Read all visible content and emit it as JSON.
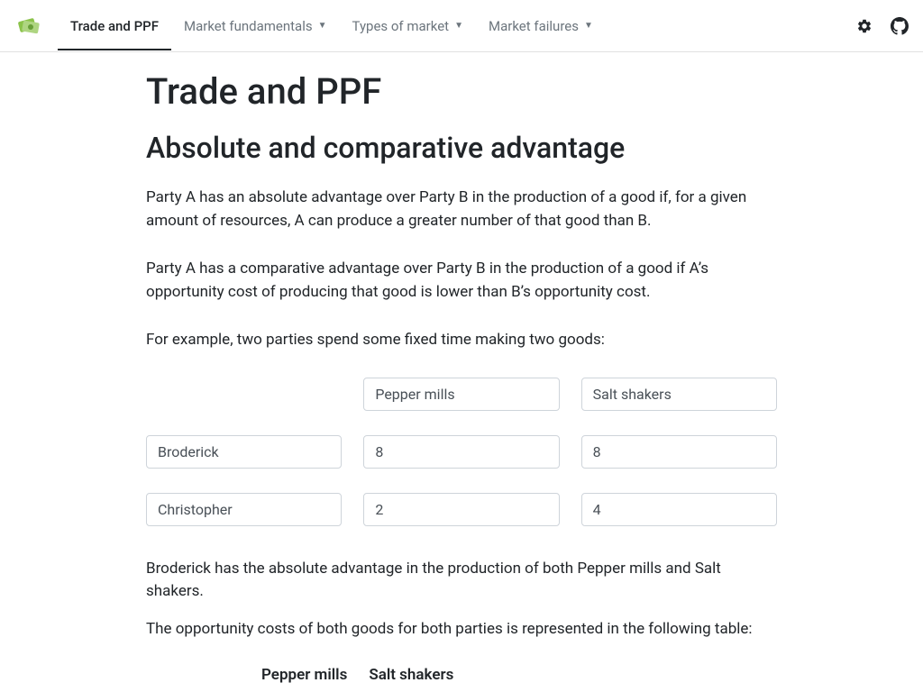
{
  "nav": {
    "active": "Trade and PPF",
    "items": [
      {
        "label": "Market fundamentals",
        "dropdown": true
      },
      {
        "label": "Types of market",
        "dropdown": true
      },
      {
        "label": "Market failures",
        "dropdown": true
      }
    ]
  },
  "page": {
    "title": "Trade and PPF",
    "subtitle": "Absolute and comparative advantage",
    "para1": "Party A has an absolute advantage over Party B in the production of a good if, for a given amount of resources, A can produce a greater number of that good than B.",
    "para2": "Party A has a comparative advantage over Party B in the production of a good if A’s opportunity cost of producing that good is lower than B’s opportunity cost.",
    "para3": "For example, two parties spend some fixed time making two goods:",
    "para4": "Broderick has the absolute advantage in the production of both Pepper mills and Salt shakers.",
    "para5": "The opportunity costs of both goods for both parties is represented in the following table:"
  },
  "inputs": {
    "good1": "Pepper mills",
    "good2": "Salt shakers",
    "partyA": "Broderick",
    "partyA_good1": "8",
    "partyA_good2": "8",
    "partyB": "Christopher",
    "partyB_good1": "2",
    "partyB_good2": "4"
  },
  "table": {
    "col1": "Pepper mills",
    "col2": "Salt shakers"
  }
}
